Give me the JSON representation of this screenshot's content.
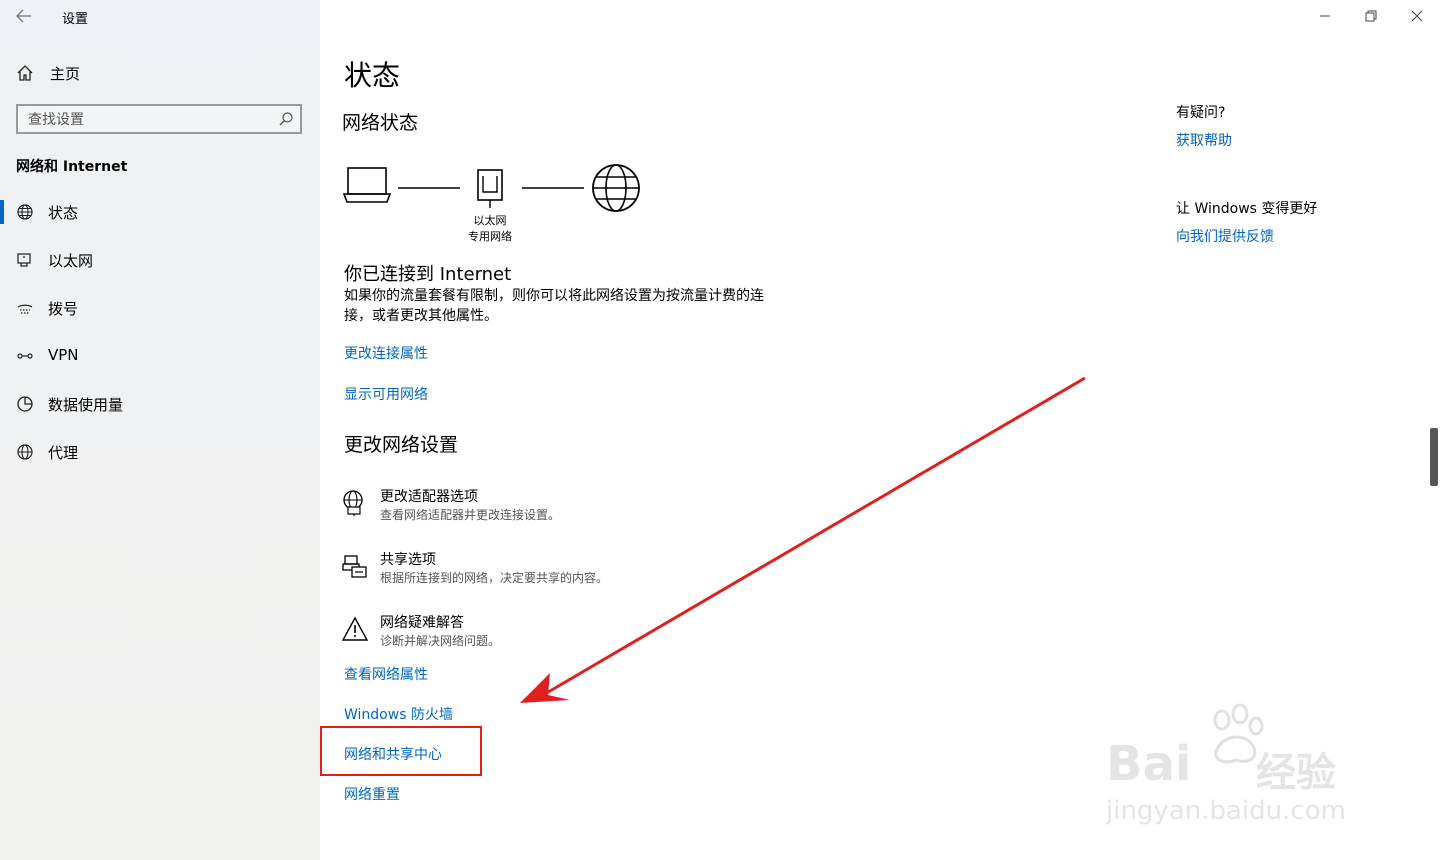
{
  "window": {
    "title": "设置",
    "minimize": "—",
    "restore": "❐",
    "close": "✕"
  },
  "sidebar": {
    "home_label": "主页",
    "search_placeholder": "查找设置",
    "section_title": "网络和 Internet",
    "items": [
      {
        "label": "状态",
        "icon": "globe-status-icon",
        "active": true
      },
      {
        "label": "以太网",
        "icon": "ethernet-icon"
      },
      {
        "label": "拨号",
        "icon": "dialup-icon"
      },
      {
        "label": "VPN",
        "icon": "vpn-icon"
      },
      {
        "label": "数据使用量",
        "icon": "data-usage-icon"
      },
      {
        "label": "代理",
        "icon": "globe-proxy-icon"
      }
    ]
  },
  "main": {
    "page_title": "状态",
    "network_status_title": "网络状态",
    "diagram_label_1": "以太网",
    "diagram_label_2": "专用网络",
    "connected_title": "你已连接到 Internet",
    "connected_desc": "如果你的流量套餐有限制，则你可以将此网络设置为按流量计费的连接，或者更改其他属性。",
    "link_change_props": "更改连接属性",
    "link_show_networks": "显示可用网络",
    "change_settings_title": "更改网络设置",
    "options": [
      {
        "title": "更改适配器选项",
        "desc": "查看网络适配器并更改连接设置。",
        "icon": "adapter-icon"
      },
      {
        "title": "共享选项",
        "desc": "根据所连接到的网络，决定要共享的内容。",
        "icon": "sharing-icon"
      },
      {
        "title": "网络疑难解答",
        "desc": "诊断并解决网络问题。",
        "icon": "warning-icon"
      }
    ],
    "link_view_props": "查看网络属性",
    "link_firewall": "Windows 防火墙",
    "link_sharing_center": "网络和共享中心",
    "link_reset": "网络重置"
  },
  "aside": {
    "question": "有疑问?",
    "get_help": "获取帮助",
    "better_title": "让 Windows 变得更好",
    "feedback": "向我们提供反馈"
  },
  "watermark": {
    "brand": "Bai",
    "brand_cn": "经验",
    "url": "jingyan.baidu.com"
  },
  "colors": {
    "accent": "#0067c0",
    "annotation": "#e02020"
  }
}
